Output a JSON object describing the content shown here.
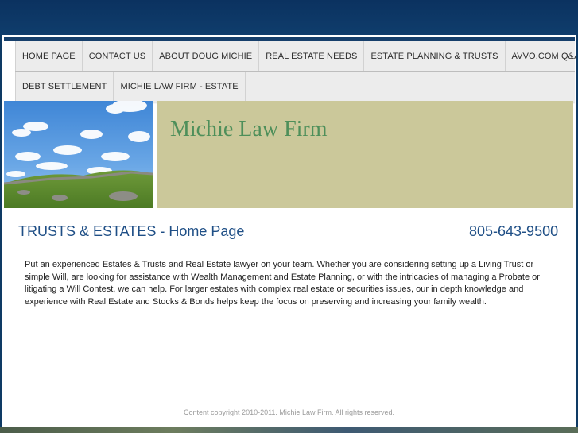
{
  "nav": {
    "row1": [
      "HOME PAGE",
      "CONTACT US",
      "ABOUT DOUG MICHIE",
      "REAL ESTATE NEEDS",
      "ESTATE PLANNING & TRUSTS",
      "AVVO.COM Q&A"
    ],
    "row2": [
      "DEBT SETTLEMENT",
      "MICHIE LAW FIRM - ESTATE"
    ]
  },
  "header": {
    "site_title": "Michie Law Firm"
  },
  "main": {
    "heading": "TRUSTS & ESTATES - Home Page",
    "phone": "805-643-9500",
    "intro": "Put an experienced Estates & Trusts and Real Estate lawyer on your team. Whether you are considering setting up a Living Trust or simple Will, are looking for assistance with Wealth Management and Estate Planning, or with the intricacies of managing a Probate or litigating a Will Contest, we can help. For larger estates with complex real estate or securities issues, our in depth knowledge and experience with Real Estate and Stocks & Bonds helps keep the focus on preserving and increasing your family wealth."
  },
  "footer": {
    "copyright": "Content copyright 2010-2011. Michie Law Firm. All rights reserved."
  },
  "colors": {
    "background": "#0e3a64",
    "banner": "#cbc89a",
    "title": "#4e8f5a",
    "heading": "#1f4f86",
    "nav_bg": "#ececec"
  }
}
